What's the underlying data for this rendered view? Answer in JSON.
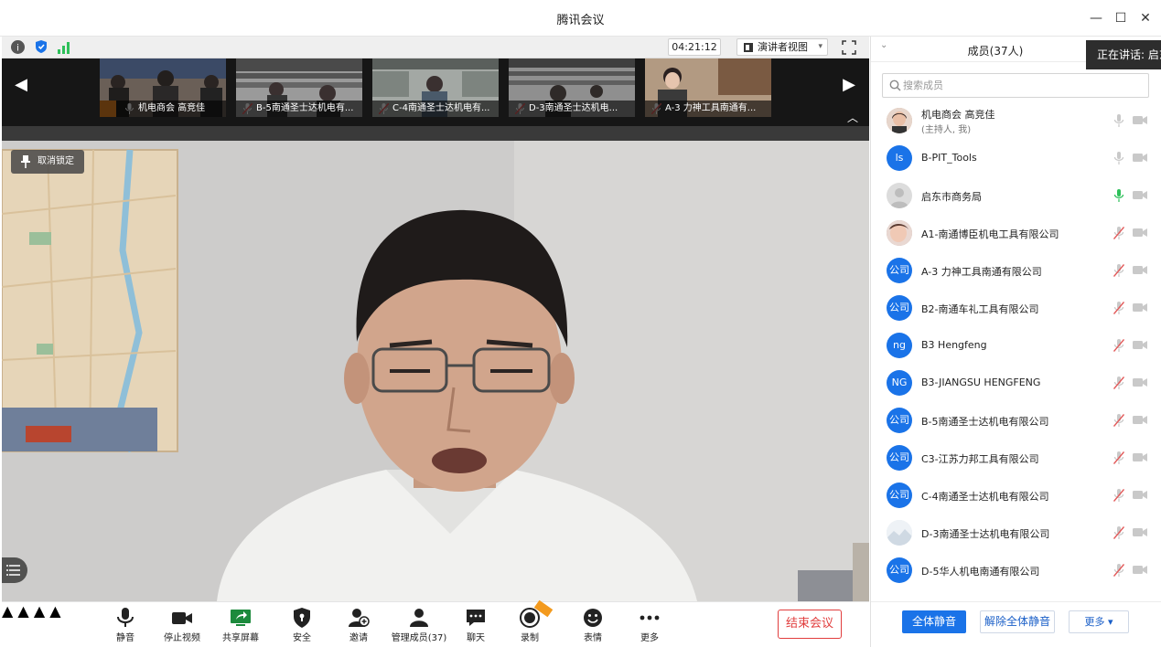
{
  "window": {
    "title": "腾讯会议",
    "minimize_label": "—",
    "maximize_label": "☐",
    "close_label": "✕"
  },
  "meeting_info": {
    "timer": "04:21:12",
    "view_mode": "演讲者视图"
  },
  "thumbnails": [
    {
      "label": "机电商会 高竞佳"
    },
    {
      "label": "B-5南通圣士达机电有..."
    },
    {
      "label": "C-4南通圣士达机电有..."
    },
    {
      "label": "D-3南通圣士达机电..."
    },
    {
      "label": "A-3 力神工具南通有..."
    }
  ],
  "stage": {
    "unpin_label": "取消锁定"
  },
  "toolbar": {
    "mute": "静音",
    "stop_video": "停止视频",
    "share_screen": "共享屏幕",
    "security": "安全",
    "invite": "邀请",
    "manage_members": "管理成员(37)",
    "chat": "聊天",
    "record": "录制",
    "reactions": "表情",
    "more": "更多",
    "end_meeting": "结束会议"
  },
  "panel": {
    "title": "成员(37人)",
    "speaking": "正在讲话: 启东",
    "search_placeholder": "搜索成员",
    "mute_all": "全体静音",
    "unmute_all": "解除全体静音",
    "more": "更多 ▾",
    "members": [
      {
        "name": "机电商会 高竞佳",
        "sub": "(主持人, 我)",
        "avatar": "photo",
        "mic": "muted-gray"
      },
      {
        "name": "B-PIT_Tools",
        "avatar_text": "ls",
        "avatar": "text",
        "mic": "gray"
      },
      {
        "name": "启东市商务局",
        "avatar": "default",
        "mic": "green"
      },
      {
        "name": "A1-南通博臣机电工具有限公司",
        "avatar": "photo2",
        "mic": "off"
      },
      {
        "name": "A-3 力神工具南通有限公司",
        "avatar_text": "公司",
        "avatar": "text",
        "mic": "off"
      },
      {
        "name": "B2-南通车礼工具有限公司",
        "avatar_text": "公司",
        "avatar": "text",
        "mic": "off"
      },
      {
        "name": "B3 Hengfeng",
        "avatar_text": "ng",
        "avatar": "text",
        "mic": "off"
      },
      {
        "name": "B3-JIANGSU HENGFENG",
        "avatar_text": "NG",
        "avatar": "text",
        "mic": "off"
      },
      {
        "name": "B-5南通圣士达机电有限公司",
        "avatar_text": "公司",
        "avatar": "text",
        "mic": "off"
      },
      {
        "name": "C3-江苏力邦工具有限公司",
        "avatar_text": "公司",
        "avatar": "text",
        "mic": "off"
      },
      {
        "name": "C-4南通圣士达机电有限公司",
        "avatar_text": "公司",
        "avatar": "text",
        "mic": "off"
      },
      {
        "name": "D-3南通圣士达机电有限公司",
        "avatar": "photo3",
        "mic": "off"
      },
      {
        "name": "D-5华人机电南通有限公司",
        "avatar_text": "公司",
        "avatar": "text",
        "mic": "off"
      }
    ]
  },
  "colors": {
    "accent": "#1a73e8",
    "danger": "#e13d3d",
    "mic_green": "#2ec05a",
    "mic_off": "#e25b5b"
  }
}
